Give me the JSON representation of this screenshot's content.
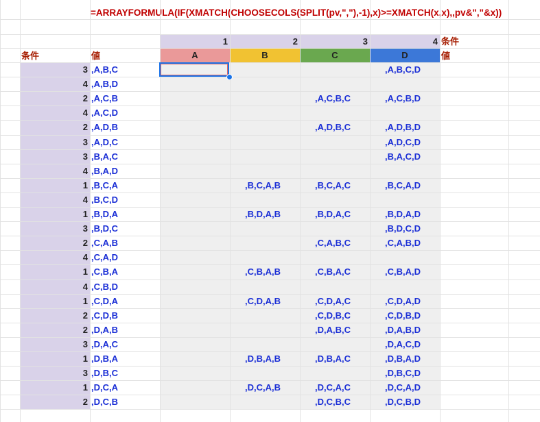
{
  "formula": "=ARRAYFORMULA(IF(XMATCH(CHOOSECOLS(SPLIT(pv,\",\"),-1),x)>=XMATCH(x,x),,pv&\",\"&x))",
  "header": {
    "label_left": "条件",
    "label_right": "条件",
    "value_label_left": "値",
    "value_label_right": "値",
    "col_numbers": [
      "1",
      "2",
      "3",
      "4"
    ],
    "col_letters": [
      "A",
      "B",
      "C",
      "D"
    ],
    "col_colors": [
      "#ea9999",
      "#f1c232",
      "#6aa84f",
      "#3c78d8"
    ]
  },
  "rows": [
    {
      "cond": "3",
      "val": ",A,B,C",
      "out": [
        "",
        "",
        "",
        ",A,B,C,D"
      ]
    },
    {
      "cond": "4",
      "val": ",A,B,D",
      "out": [
        "",
        "",
        "",
        ""
      ]
    },
    {
      "cond": "2",
      "val": ",A,C,B",
      "out": [
        "",
        "",
        ",A,C,B,C",
        ",A,C,B,D"
      ]
    },
    {
      "cond": "4",
      "val": ",A,C,D",
      "out": [
        "",
        "",
        "",
        ""
      ]
    },
    {
      "cond": "2",
      "val": ",A,D,B",
      "out": [
        "",
        "",
        ",A,D,B,C",
        ",A,D,B,D"
      ]
    },
    {
      "cond": "3",
      "val": ",A,D,C",
      "out": [
        "",
        "",
        "",
        ",A,D,C,D"
      ]
    },
    {
      "cond": "3",
      "val": ",B,A,C",
      "out": [
        "",
        "",
        "",
        ",B,A,C,D"
      ]
    },
    {
      "cond": "4",
      "val": ",B,A,D",
      "out": [
        "",
        "",
        "",
        ""
      ]
    },
    {
      "cond": "1",
      "val": ",B,C,A",
      "out": [
        "",
        ",B,C,A,B",
        ",B,C,A,C",
        ",B,C,A,D"
      ]
    },
    {
      "cond": "4",
      "val": ",B,C,D",
      "out": [
        "",
        "",
        "",
        ""
      ]
    },
    {
      "cond": "1",
      "val": ",B,D,A",
      "out": [
        "",
        ",B,D,A,B",
        ",B,D,A,C",
        ",B,D,A,D"
      ]
    },
    {
      "cond": "3",
      "val": ",B,D,C",
      "out": [
        "",
        "",
        "",
        ",B,D,C,D"
      ]
    },
    {
      "cond": "2",
      "val": ",C,A,B",
      "out": [
        "",
        "",
        ",C,A,B,C",
        ",C,A,B,D"
      ]
    },
    {
      "cond": "4",
      "val": ",C,A,D",
      "out": [
        "",
        "",
        "",
        ""
      ]
    },
    {
      "cond": "1",
      "val": ",C,B,A",
      "out": [
        "",
        ",C,B,A,B",
        ",C,B,A,C",
        ",C,B,A,D"
      ]
    },
    {
      "cond": "4",
      "val": ",C,B,D",
      "out": [
        "",
        "",
        "",
        ""
      ]
    },
    {
      "cond": "1",
      "val": ",C,D,A",
      "out": [
        "",
        ",C,D,A,B",
        ",C,D,A,C",
        ",C,D,A,D"
      ]
    },
    {
      "cond": "2",
      "val": ",C,D,B",
      "out": [
        "",
        "",
        ",C,D,B,C",
        ",C,D,B,D"
      ]
    },
    {
      "cond": "2",
      "val": ",D,A,B",
      "out": [
        "",
        "",
        ",D,A,B,C",
        ",D,A,B,D"
      ]
    },
    {
      "cond": "3",
      "val": ",D,A,C",
      "out": [
        "",
        "",
        "",
        ",D,A,C,D"
      ]
    },
    {
      "cond": "1",
      "val": ",D,B,A",
      "out": [
        "",
        ",D,B,A,B",
        ",D,B,A,C",
        ",D,B,A,D"
      ]
    },
    {
      "cond": "3",
      "val": ",D,B,C",
      "out": [
        "",
        "",
        "",
        ",D,B,C,D"
      ]
    },
    {
      "cond": "1",
      "val": ",D,C,A",
      "out": [
        "",
        ",D,C,A,B",
        ",D,C,A,C",
        ",D,C,A,D"
      ]
    },
    {
      "cond": "2",
      "val": ",D,C,B",
      "out": [
        "",
        "",
        ",D,C,B,C",
        ",D,C,B,D"
      ]
    }
  ]
}
